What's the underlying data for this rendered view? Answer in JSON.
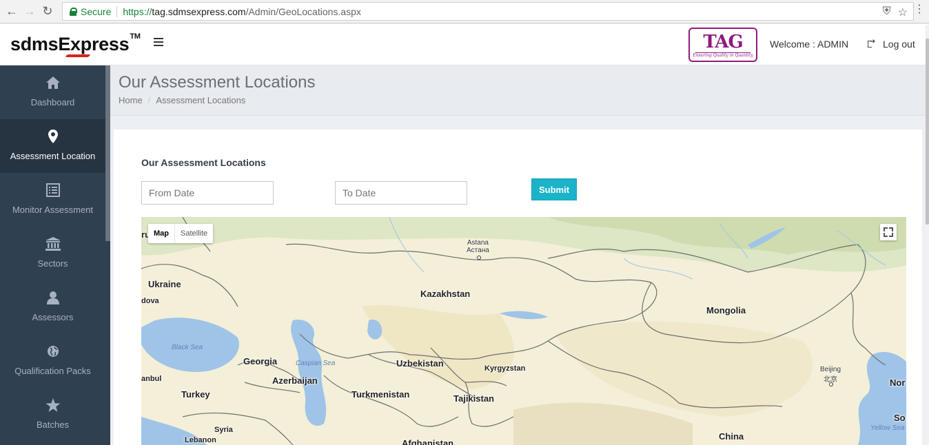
{
  "browser": {
    "secure_label": "Secure",
    "url_https": "https://",
    "url_host": "tag.sdmsexpress.com",
    "url_path": "/Admin/GeoLocations.aspx"
  },
  "header": {
    "logo_text_1": "sdmsE",
    "logo_text_x": "x",
    "logo_text_2": "press",
    "logo_tm": "TM",
    "partner_logo": "TAG",
    "partner_tagline": "Ensuring Quality in Quantity",
    "welcome": "Welcome : ADMIN",
    "logout": "Log out"
  },
  "sidebar": {
    "items": [
      {
        "label": "Dashboard",
        "icon": "home-icon"
      },
      {
        "label": "Assessment Location",
        "icon": "map-marker-icon",
        "active": true
      },
      {
        "label": "Monitor Assessment",
        "icon": "list-alt-icon"
      },
      {
        "label": "Sectors",
        "icon": "institution-icon"
      },
      {
        "label": "Assessors",
        "icon": "user-icon"
      },
      {
        "label": "Qualification Packs",
        "icon": "globe-icon"
      },
      {
        "label": "Batches",
        "icon": "star-icon"
      }
    ]
  },
  "page": {
    "title": "Our Assessment Locations",
    "breadcrumb": [
      "Home",
      "Assessment Locations"
    ],
    "panel_title": "Our Assessment Locations",
    "from_placeholder": "From Date",
    "to_placeholder": "To Date",
    "submit": "Submit"
  },
  "map": {
    "type_map": "Map",
    "type_satellite": "Satellite",
    "labels": {
      "ru": "ru",
      "ukraine": "Ukraine",
      "moldova": "dova",
      "kazakhstan": "Kazakhstan",
      "astana_1": "Astana",
      "astana_2": "Астана",
      "mongolia": "Mongolia",
      "black_sea": "Black Sea",
      "georgia": "Georgia",
      "caspian_sea": "Caspian Sea",
      "uzbekistan": "Uzbekistan",
      "kyrgyzstan": "Kyrgyzstan",
      "istanbul": "anbul",
      "azerbaijan": "Azerbaijan",
      "turkey": "Turkey",
      "turkmenistan": "Turkmenistan",
      "tajikistan": "Tajikistan",
      "syria": "Syria",
      "lebanon": "Lebanon",
      "afghanistan": "Afghanistan",
      "china": "China",
      "beijing_1": "Beijing",
      "beijing_2": "北京",
      "north": "Nor",
      "south": "So",
      "yellow_sea": "Yellow Sea"
    }
  }
}
